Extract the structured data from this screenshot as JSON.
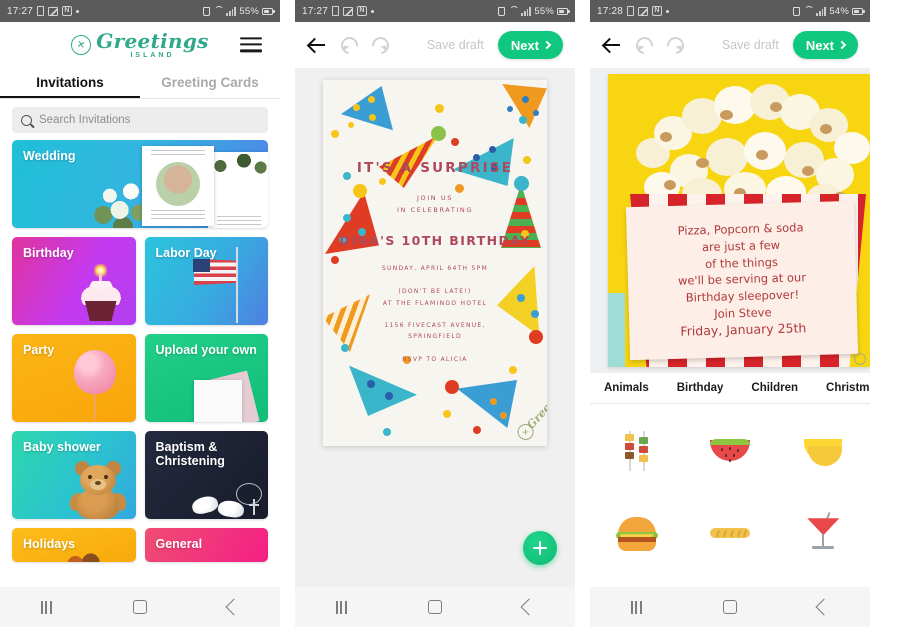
{
  "panel1": {
    "statusbar": {
      "time": "17:27",
      "battery": "55%",
      "icons": [
        "music-note-icon",
        "photo-icon",
        "notion-icon",
        "dot-icon"
      ],
      "right_icons": [
        "lock-icon",
        "wifi-icon",
        "signal-icon",
        "battery-icon"
      ]
    },
    "logo": {
      "name": "Greetings",
      "sub": "ISLAND"
    },
    "menu_icon": "hamburger-menu-icon",
    "tabs": [
      {
        "label": "Invitations",
        "active": true
      },
      {
        "label": "Greeting Cards",
        "active": false
      }
    ],
    "search": {
      "placeholder": "Search Invitations",
      "icon": "search-icon"
    },
    "tiles": [
      {
        "label": "Wedding",
        "color": "#1fc0d8"
      },
      {
        "label": "Birthday",
        "color": "#d63af0"
      },
      {
        "label": "Labor Day",
        "color": "#2ab9d8"
      },
      {
        "label": "Party",
        "color": "#f9a90b"
      },
      {
        "label": "Upload your own",
        "color": "#17c47e"
      },
      {
        "label": "Baby shower",
        "color": "#2ecfb0"
      },
      {
        "label": "Baptism & Christening",
        "color": "#1d2235"
      },
      {
        "label": "Holidays",
        "color": "#f9b413"
      },
      {
        "label": "General",
        "color": "#f0417d"
      }
    ],
    "navbar": [
      "recents-button",
      "home-button",
      "back-button"
    ]
  },
  "panel2": {
    "statusbar": {
      "time": "17:27",
      "battery": "55%"
    },
    "toolbar": {
      "back_icon": "back-arrow-icon",
      "undo_icon": "undo-icon",
      "redo_icon": "redo-icon",
      "save_draft": "Save draft",
      "next": "Next"
    },
    "invitation": {
      "title": "IT'S A SURPRISE",
      "subtitle_1": "JOIN US",
      "subtitle_2": "IN CELEBRATING",
      "headline": "DINA'S 10TH BIRTHDAY",
      "date": "SUNDAY, APRIL 64TH 5PM",
      "note_1": "(DON'T BE LATE!)",
      "note_2": "AT THE FLAMINGO HOTEL",
      "address_1": "1156 FIVECAST AVENUE,",
      "address_2": "SPRINGFIELD",
      "rsvp": "RSVP TO ALICIA",
      "watermark": "Greetings",
      "bg_color": "#f7f5f0",
      "text_color": "#b0485c"
    },
    "fab": {
      "icon": "add-plus-icon",
      "color": "#10c77f"
    }
  },
  "panel3": {
    "statusbar": {
      "time": "17:28",
      "battery": "54%"
    },
    "toolbar": {
      "save_draft": "Save draft",
      "next": "Next"
    },
    "card": {
      "bg_color": "#f7d511",
      "lines": [
        "Pizza, Popcorn &  soda",
        "are just a few",
        "of the things",
        "we'll be serving at our",
        "Birthday sleepover!",
        "Join Steve",
        "Friday, January 25th"
      ],
      "text_color": "#b03a3a"
    },
    "category_tabs": [
      "Animals",
      "Birthday",
      "Children",
      "Christmas"
    ],
    "stickers": [
      {
        "name": "kebab-skewer-sticker"
      },
      {
        "name": "watermelon-sticker"
      },
      {
        "name": "banana-sticker"
      },
      {
        "name": "hamburger-sticker"
      },
      {
        "name": "baguette-sticker"
      },
      {
        "name": "cocktail-sticker"
      }
    ]
  }
}
